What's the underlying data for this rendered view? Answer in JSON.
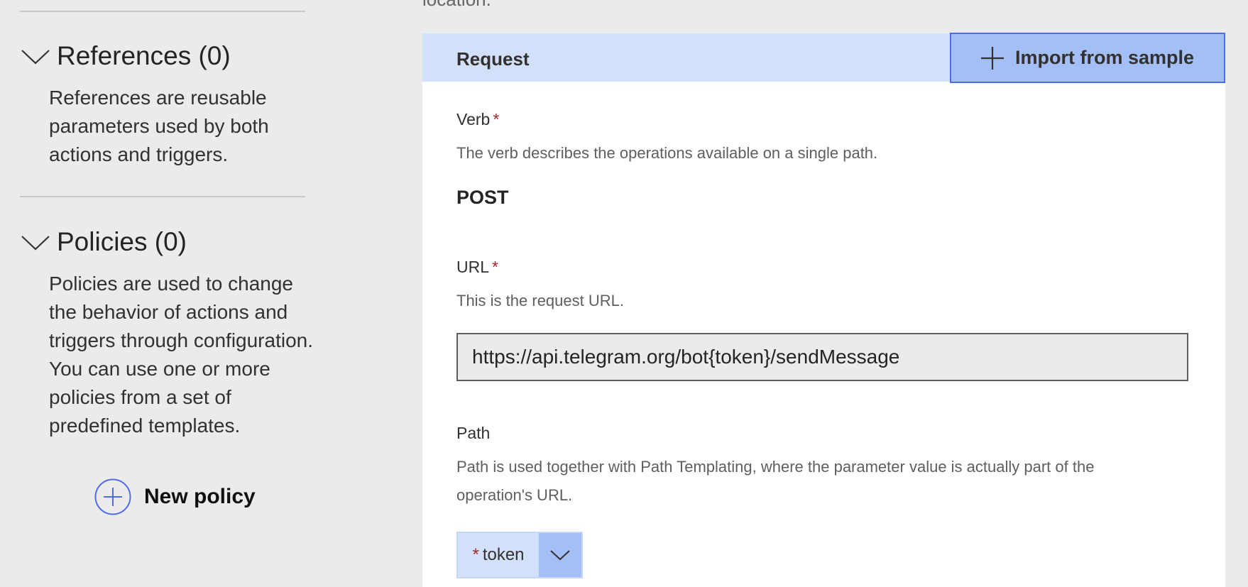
{
  "sidebar": {
    "references": {
      "title": "References (0)",
      "description": "References are reusable parameters used by both actions and triggers.",
      "chevron_icon": "chevron-down-icon"
    },
    "policies": {
      "title": "Policies (0)",
      "description": "Policies are used to change the behavior of actions and triggers through configuration. You can use one or more policies from a set of predefined templates.",
      "chevron_icon": "chevron-down-icon",
      "new_policy_label": "New policy",
      "new_policy_icon": "circle-plus-icon"
    }
  },
  "main": {
    "location_text": "location.",
    "request": {
      "header_title": "Request",
      "import_button_label": "Import from sample",
      "import_icon": "plus-icon",
      "verb": {
        "label": "Verb",
        "required_mark": "*",
        "description": "The verb describes the operations available on a single path.",
        "value": "POST"
      },
      "url": {
        "label": "URL",
        "required_mark": "*",
        "description": "This is the request URL.",
        "value": "https://api.telegram.org/bot{token}/sendMessage"
      },
      "path": {
        "label": "Path",
        "description": "Path is used together with Path Templating, where the parameter value is actually part of the operation's URL.",
        "param": {
          "required_mark": "*",
          "name": "token",
          "dropdown_icon": "chevron-down-icon"
        }
      }
    }
  },
  "colors": {
    "page_background": "#ebebeb",
    "panel_header": "#d2e0fa",
    "import_button": "#a3bff6",
    "import_button_border": "#4f6bed",
    "circle_accent": "#4f6bed",
    "required": "#a4262c"
  }
}
